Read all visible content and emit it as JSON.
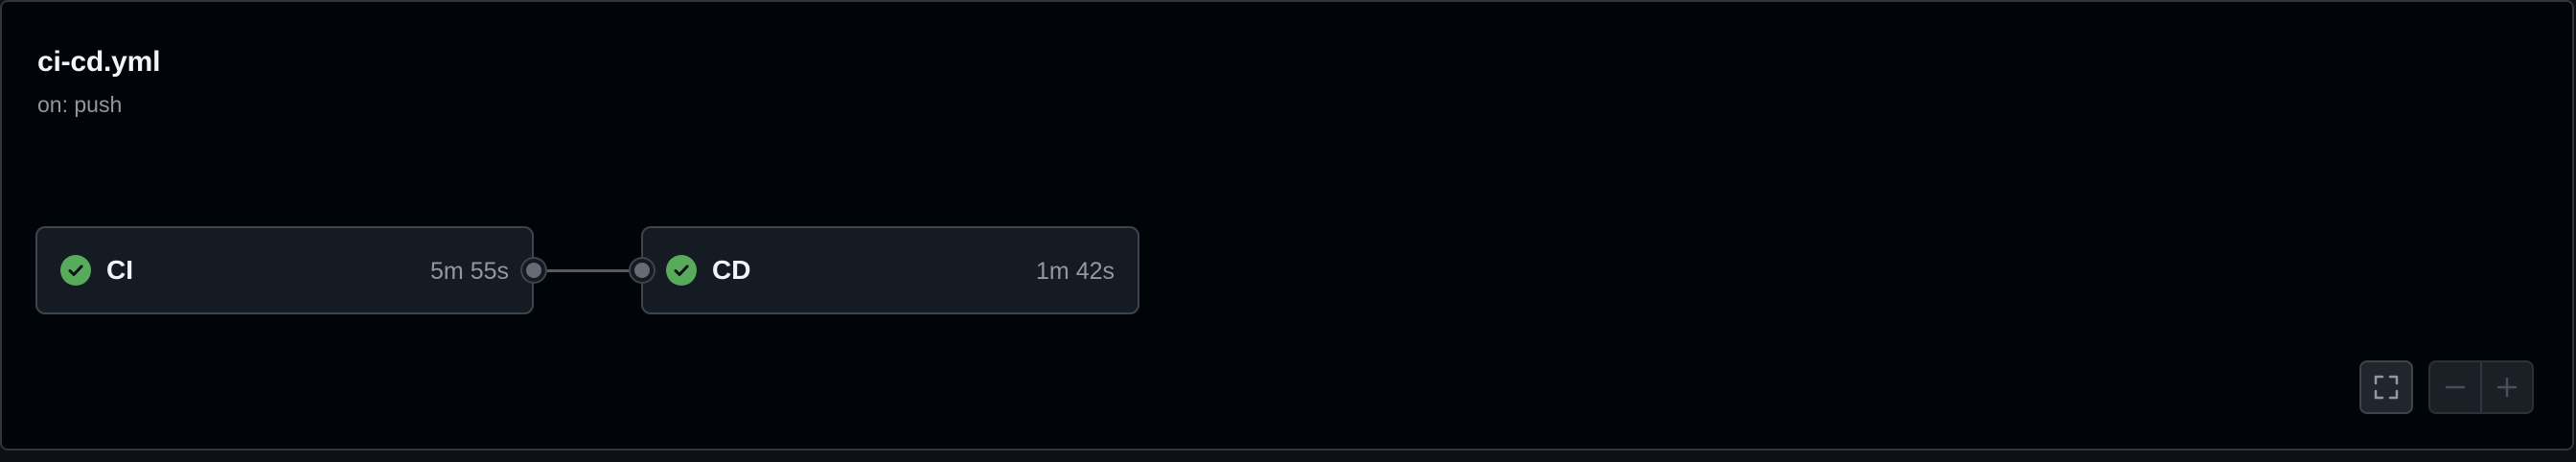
{
  "workflow": {
    "title": "ci-cd.yml",
    "trigger": "on: push"
  },
  "jobs": [
    {
      "name": "CI",
      "duration": "5m 55s",
      "status": "success",
      "status_icon": "check-circle-icon"
    },
    {
      "name": "CD",
      "duration": "1m 42s",
      "status": "success",
      "status_icon": "check-circle-icon"
    }
  ],
  "controls": {
    "fullscreen_icon": "fullscreen-icon",
    "zoom_out_icon": "minus-icon",
    "zoom_in_icon": "plus-icon",
    "zoom_enabled": false
  },
  "colors": {
    "background": "#010409",
    "card": "#151b23",
    "success": "#57ab5a",
    "text": "#f0f6fc",
    "muted": "#9198a1"
  }
}
